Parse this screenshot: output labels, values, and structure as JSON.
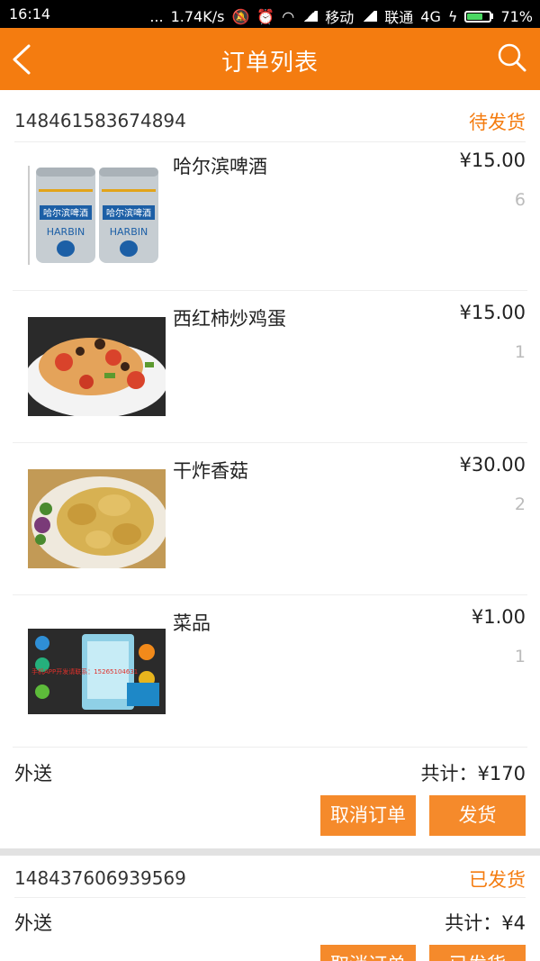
{
  "status_bar": {
    "time": "16:14",
    "dots": "...",
    "speed": "1.74K/s",
    "carrier1": "移动",
    "carrier2": "联通",
    "network": "4G",
    "battery": "71%"
  },
  "nav": {
    "title": "订单列表",
    "back_icon": "chevron-left-icon",
    "search_icon": "search-icon"
  },
  "orders": [
    {
      "order_no": "148461583674894",
      "status": "待发货",
      "items": [
        {
          "name": "哈尔滨啤酒",
          "price": "¥15.00",
          "qty": "6",
          "image": "beer-can-image",
          "can_brand_cn": "哈尔滨啤酒",
          "can_brand_en": "HARBIN"
        },
        {
          "name": "西红柿炒鸡蛋",
          "price": "¥15.00",
          "qty": "1",
          "image": "tomato-egg-dish-image"
        },
        {
          "name": "干炸香菇",
          "price": "¥30.00",
          "qty": "2",
          "image": "fried-mushroom-dish-image"
        },
        {
          "name": "菜品",
          "price": "¥1.00",
          "qty": "1",
          "image": "app-promo-image",
          "promo_text": "手机APP开发请联系：15265104631"
        }
      ],
      "delivery": "外送",
      "total": "共计：¥170",
      "actions": {
        "cancel": "取消订单",
        "ship": "发货"
      }
    },
    {
      "order_no": "148437606939569",
      "status": "已发货",
      "delivery": "外送",
      "total": "共计：¥4",
      "actions": {
        "cancel": "取消订单",
        "ship": "已发货"
      }
    }
  ],
  "colors": {
    "accent": "#f47c10",
    "button": "#f58a2b",
    "divider": "#e2e2e2"
  }
}
